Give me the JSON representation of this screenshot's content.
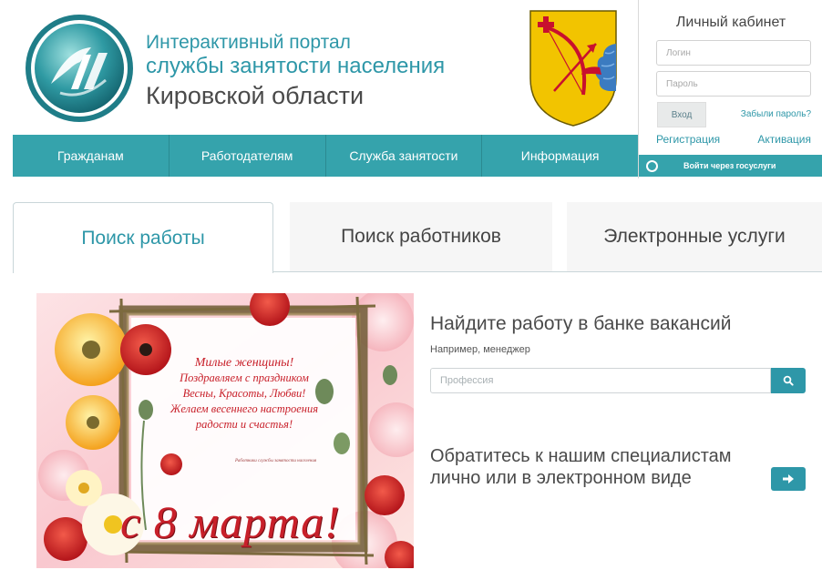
{
  "brand": {
    "line1": "Интерактивный портал",
    "line2": "службы занятости населения",
    "line3": "Кировской области",
    "logo_icon": "portal-logo-icon",
    "coat_icon": "kirov-coat-of-arms-icon"
  },
  "nav": {
    "items": [
      {
        "label": "Гражданам"
      },
      {
        "label": "Работодателям"
      },
      {
        "label": "Служба занятости"
      },
      {
        "label": "Информация"
      }
    ]
  },
  "login": {
    "title": "Личный кабинет",
    "login_placeholder": "Логин",
    "password_placeholder": "Пароль",
    "submit_label": "Вход",
    "forgot_label": "Забыли пароль?",
    "register_label": "Регистрация",
    "activate_label": "Активация",
    "gosuslugi_label": "Войти через госуслуги"
  },
  "tabs": {
    "items": [
      {
        "label": "Поиск работы",
        "active": true
      },
      {
        "label": "Поиск работников",
        "active": false
      },
      {
        "label": "Электронные услуги",
        "active": false
      }
    ]
  },
  "banner": {
    "greeting": [
      "Милые женщины!",
      "Поздравляем с праздником",
      "Весны, Красоты, Любви!",
      "Желаем весеннего настроения",
      "радости и счастья!"
    ],
    "signature": "Работники службы занятости населения",
    "date_title": "с 8 марта!"
  },
  "search": {
    "title": "Найдите работу в банке вакансий",
    "hint": "Например, менеджер",
    "placeholder": "Профессия",
    "button_icon": "search-icon"
  },
  "contact": {
    "line1": "Обратитесь к нашим специалистам",
    "line2": "лично или в электронном виде",
    "button_icon": "arrow-right-icon"
  },
  "colors": {
    "accent": "#2e97a8",
    "nav_bg": "#35a3ac",
    "greeting_red": "#c8202a"
  }
}
